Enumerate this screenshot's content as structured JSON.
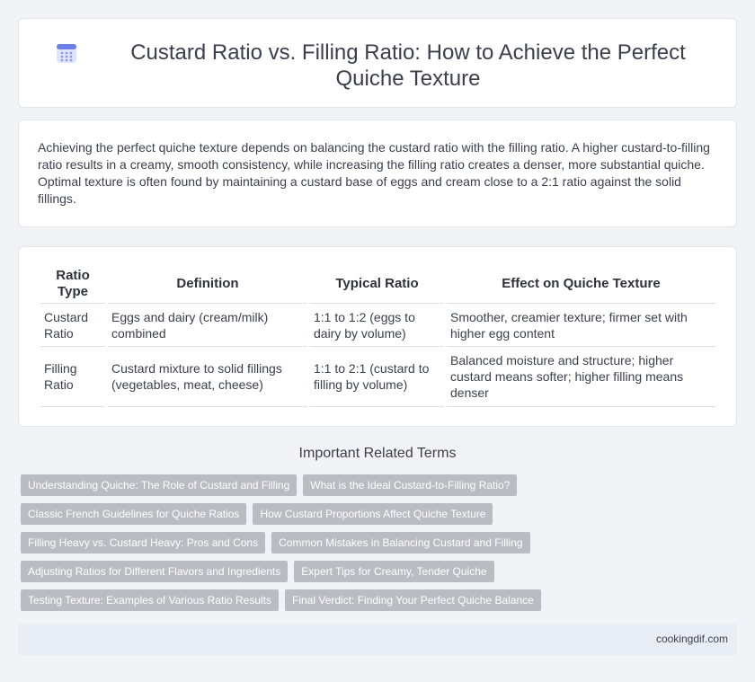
{
  "header": {
    "icon": "calendar-icon",
    "title": "Custard Ratio vs. Filling Ratio: How to Achieve the Perfect Quiche Texture"
  },
  "intro": {
    "text": "Achieving the perfect quiche texture depends on balancing the custard ratio with the filling ratio. A higher custard-to-filling ratio results in a creamy, smooth consistency, while increasing the filling ratio creates a denser, more substantial quiche. Optimal texture is often found by maintaining a custard base of eggs and cream close to a 2:1 ratio against the solid fillings."
  },
  "table": {
    "headers": [
      "Ratio Type",
      "Definition",
      "Typical Ratio",
      "Effect on Quiche Texture"
    ],
    "rows": [
      [
        "Custard Ratio",
        "Eggs and dairy (cream/milk) combined",
        "1:1 to 1:2 (eggs to dairy by volume)",
        "Smoother, creamier texture; firmer set with higher egg content"
      ],
      [
        "Filling Ratio",
        "Custard mixture to solid fillings (vegetables, meat, cheese)",
        "1:1 to 2:1 (custard to filling by volume)",
        "Balanced moisture and structure; higher custard means softer; higher filling means denser"
      ]
    ]
  },
  "related": {
    "title": "Important Related Terms",
    "tags": [
      [
        "Understanding Quiche: The Role of Custard and Filling",
        "What is the Ideal Custard-to-Filling Ratio?"
      ],
      [
        "Classic French Guidelines for Quiche Ratios",
        "How Custard Proportions Affect Quiche Texture"
      ],
      [
        "Filling Heavy vs. Custard Heavy: Pros and Cons",
        "Common Mistakes in Balancing Custard and Filling"
      ],
      [
        "Adjusting Ratios for Different Flavors and Ingredients",
        "Expert Tips for Creamy, Tender Quiche"
      ],
      [
        "Testing Texture: Examples of Various Ratio Results",
        "Final Verdict: Finding Your Perfect Quiche Balance"
      ]
    ]
  },
  "footer": {
    "site": "cookingdif.com"
  }
}
